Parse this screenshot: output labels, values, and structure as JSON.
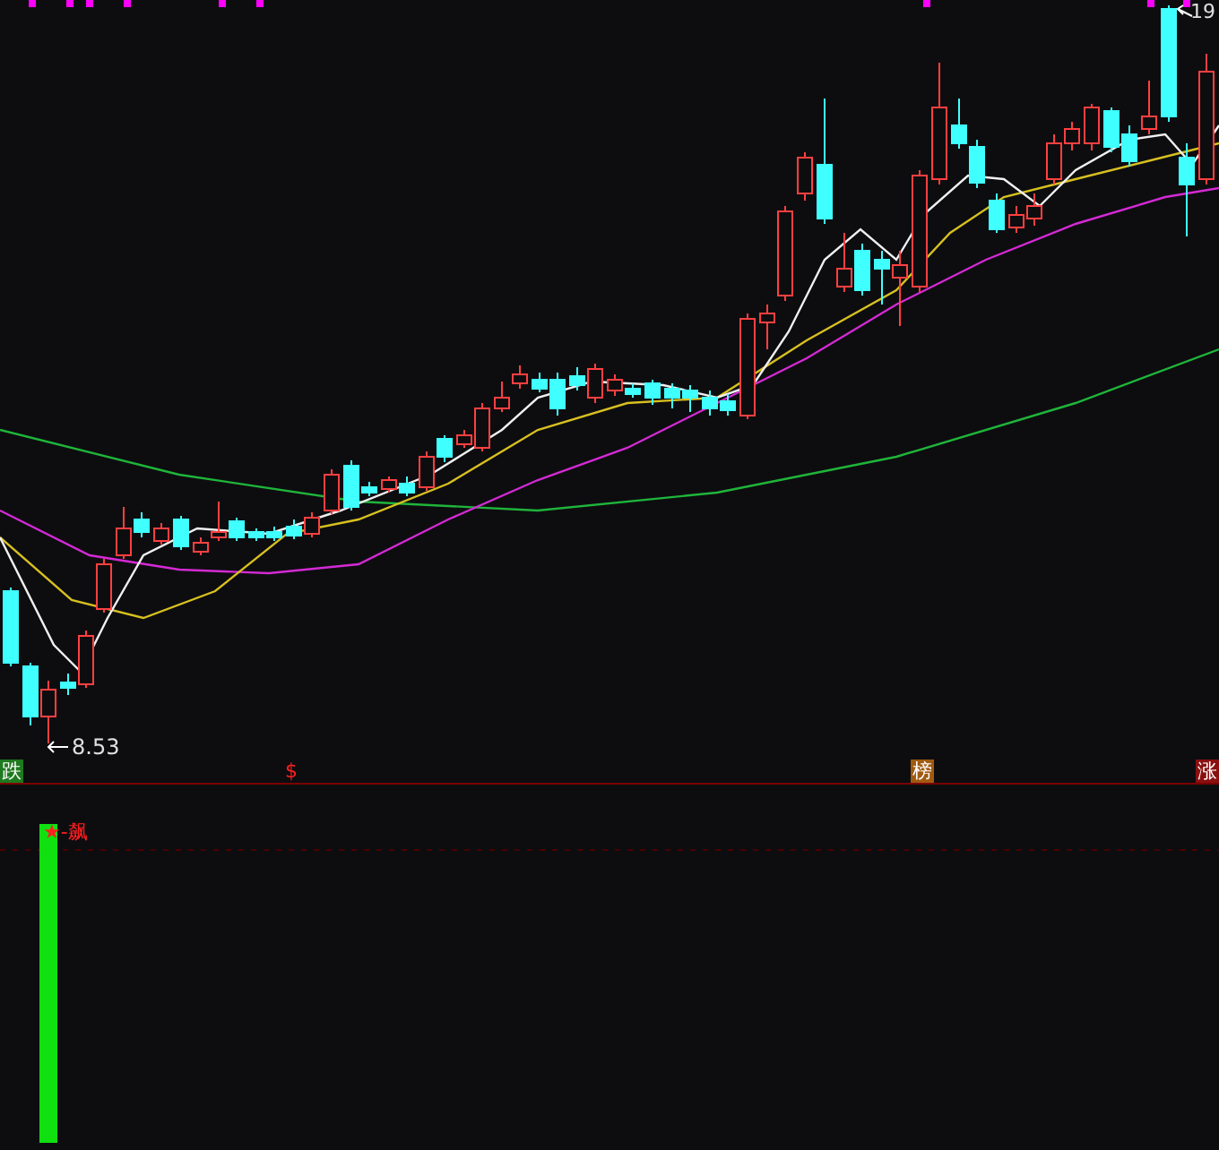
{
  "price_chart": {
    "high_label": "19",
    "low_label": "8.53"
  },
  "signals": [
    {
      "text": "跌",
      "kind": "badge",
      "color": "#1e7a1e"
    },
    {
      "text": "$",
      "kind": "plain",
      "color": "#ff2020"
    },
    {
      "text": "榜",
      "kind": "badge",
      "color": "#a05a10"
    },
    {
      "text": "涨",
      "kind": "badge",
      "color": "#8a1010"
    }
  ],
  "indicator": {
    "legend": "★-飙"
  }
}
